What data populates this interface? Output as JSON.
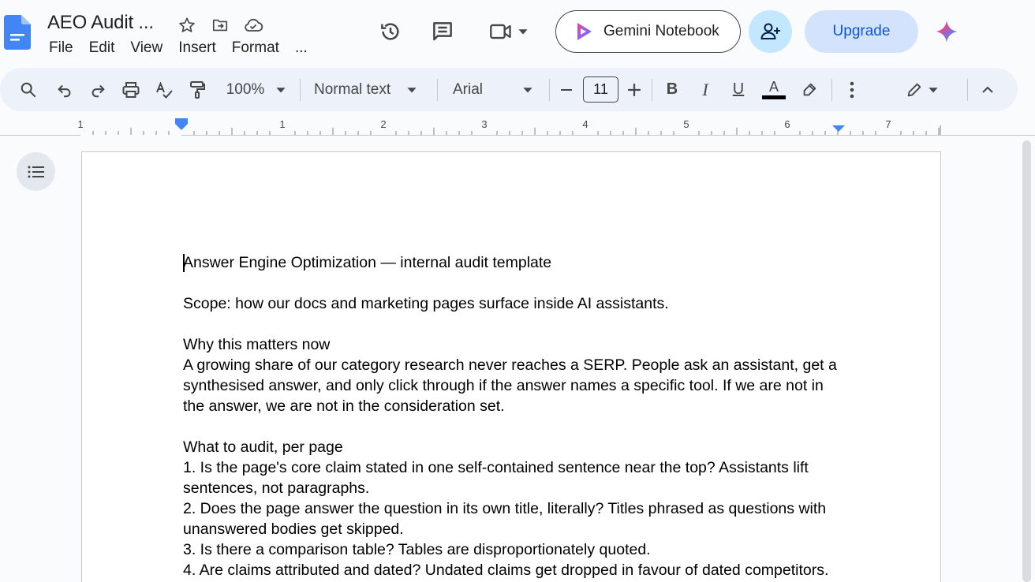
{
  "header": {
    "title": "AEO Audit ...",
    "menu": [
      "File",
      "Edit",
      "View",
      "Insert",
      "Format",
      "..."
    ],
    "gemini_notebook_label": "Gemini Notebook",
    "upgrade_label": "Upgrade"
  },
  "toolbar": {
    "zoom": "100%",
    "style": "Normal text",
    "font": "Arial",
    "font_size": "11"
  },
  "ruler": {
    "labels": [
      "1",
      "1",
      "2",
      "3",
      "4",
      "5",
      "6",
      "7"
    ]
  },
  "document": {
    "paragraphs": [
      "Answer Engine Optimization — internal audit template",
      "",
      "Scope: how our docs and marketing pages surface inside AI assistants.",
      "",
      "Why this matters now",
      "A growing share of our category research never reaches a SERP. People ask an assistant, get a synthesised answer, and only click through if the answer names a specific tool. If we are not in the answer, we are not in the consideration set.",
      "",
      "What to audit, per page",
      "1. Is the page's core claim stated in one self-contained sentence near the top? Assistants lift sentences, not paragraphs.",
      "2. Does the page answer the question in its own title, literally? Titles phrased as questions with unanswered bodies get skipped.",
      "3. Is there a comparison table? Tables are disproportionately quoted.",
      "4. Are claims attributed and dated? Undated claims get dropped in favour of dated competitors."
    ]
  },
  "icons": {
    "doc_logo": "docs-logo-icon",
    "star": "star-icon",
    "move": "move-to-folder-icon",
    "cloud": "cloud-saved-icon",
    "history": "version-history-icon",
    "comments": "comments-icon",
    "meet": "meet-icon",
    "share": "share-icon",
    "gemini": "gemini-spark-icon"
  },
  "colors": {
    "accent": "#0b57d0",
    "share_bg": "#c2e7ff",
    "upgrade_bg": "#d3e3fd",
    "toolbar_bg": "#edf2fa"
  }
}
